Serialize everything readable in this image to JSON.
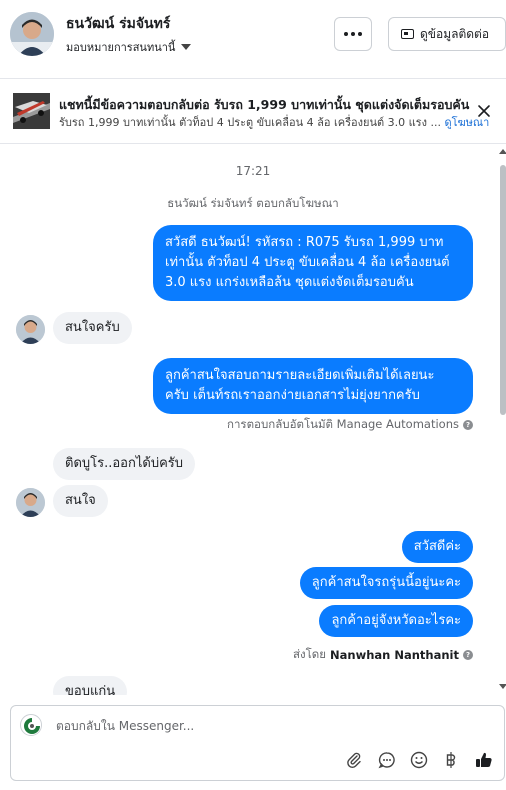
{
  "header": {
    "contact_name": "ธนวัฒน์ ร่มจันทร์",
    "assign_label": "มอบหมายการสนทนานี้",
    "more_icon": "more-horizontal-icon",
    "view_contact_label": "ดูข้อมูลติดต่อ",
    "contact_card_icon": "contact-card-icon"
  },
  "ad": {
    "title": "แชทนี้มีข้อความตอบกลับต่อ รับรถ 1,999 บาทเท่านั้น ชุดแต่งจัดเต็มรอบคัน",
    "description": "รับรถ 1,999 บาทเท่านั้น ตัวท็อป 4 ประตู ขับเคลื่อน 4 ล้อ เครื่องยนต์ 3.0 แรง ...",
    "link_label": "ดูโฆษณา"
  },
  "thread": {
    "timestamp": "17:21",
    "replied_to_ad_note": "ธนวัฒน์ ร่มจันทร์ ตอบกลับโฆษณา",
    "messages": [
      {
        "from": "page",
        "text_lines": [
          "สวัสดี ธนวัฒน์! รหัสรถ : R075 รับรถ 1,999 บาท",
          "เท่านั้น ตัวท็อป 4 ประตู ขับเคลื่อน 4 ล้อ  เครื่องยนต์",
          "3.0 แรง แกร่งเหลือล้น ชุดแต่งจัดเต็มรอบคัน"
        ]
      },
      {
        "from": "customer",
        "text": "สนใจครับ"
      },
      {
        "from": "page",
        "text_lines": [
          "ลูกค้าสนใจสอบถามรายละเอียดเพิ่มเติมได้เลยนะ",
          "ครับ เต็นท์รถเราออกง่ายเอกสารไม่ยุ่งยากครับ"
        ]
      },
      {
        "from": "customer",
        "text": "ติดบูโร..ออกได้บ่ครับ"
      },
      {
        "from": "customer",
        "text": "สนใจ"
      },
      {
        "from": "page",
        "text": "สวัสดีค่ะ"
      },
      {
        "from": "page",
        "text": "ลูกค้าสนใจรถรุ่นนี้อยู่นะคะ"
      },
      {
        "from": "page",
        "text": "ลูกค้าอยู่จังหวัดอะไรคะ"
      },
      {
        "from": "customer",
        "text": "ขอบแก่น"
      }
    ],
    "automation_note": "การตอบกลับอัตโนมัติ Manage Automations",
    "sent_by_label": "ส่งโดย",
    "sent_by_name": "Nanwhan Nanthanit"
  },
  "composer": {
    "placeholder": "ตอบกลับใน Messenger...",
    "tools": [
      "attachment-icon",
      "saved-reply-icon",
      "emoji-icon",
      "baht-payment-icon",
      "like-icon"
    ]
  },
  "colors": {
    "outgoing_bubble": "#0a7cff",
    "incoming_bubble": "#f0f2f5",
    "link": "#1a6fd6",
    "like": "#1c1e21"
  }
}
